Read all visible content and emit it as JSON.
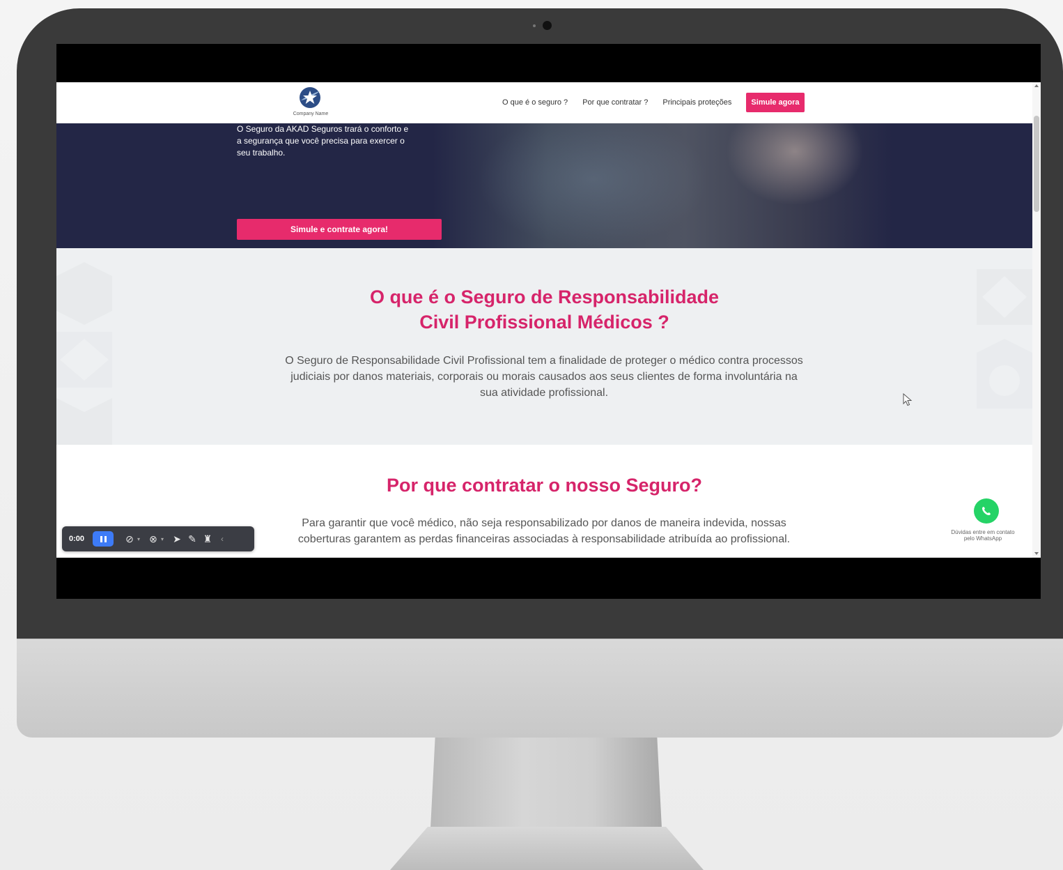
{
  "site": {
    "logo_text": "Company Name",
    "nav": [
      {
        "label": "O que é o seguro ?"
      },
      {
        "label": "Por que contratar ?"
      },
      {
        "label": "Principais proteções"
      }
    ],
    "nav_cta": "Simule agora"
  },
  "hero": {
    "text_lines": [
      "O Seguro da AKAD Seguros trará o conforto e",
      "a segurança que você precisa para exercer o",
      "seu trabalho."
    ],
    "button": "Simule e contrate agora!"
  },
  "section_what": {
    "title_line1": "O que é o Seguro de Responsabilidade",
    "title_line2": "Civil Profissional Médicos ?",
    "body_line1": "O Seguro de Responsabilidade Civil Profissional tem a finalidade de proteger o médico contra processos",
    "body_line2": "judiciais por danos materiais, corporais ou morais causados aos seus clientes de forma involuntária na",
    "body_line3": "sua atividade profissional."
  },
  "section_why": {
    "title": "Por que contratar o nosso Seguro?",
    "body_line1": "Para garantir que você médico, não seja responsabilizado por danos de maneira indevida, nossas",
    "body_line2": "coberturas garantem as perdas financeiras associadas à responsabilidade atribuída ao profissional."
  },
  "whatsapp": {
    "line1": "Dúvidas entre em contato",
    "line2": "pelo WhatsApp"
  },
  "recorder": {
    "time": "0:00",
    "tools": [
      "mic-off-icon",
      "camera-off-icon",
      "pointer-icon",
      "pen-icon",
      "eraser-icon"
    ]
  },
  "colors": {
    "accent": "#e72b6c",
    "hero_bg": "#232646",
    "section_bg": "#eef0f2",
    "whatsapp": "#25d366",
    "recorder_bg": "#3b3d44",
    "recorder_active": "#3d7bf7"
  }
}
